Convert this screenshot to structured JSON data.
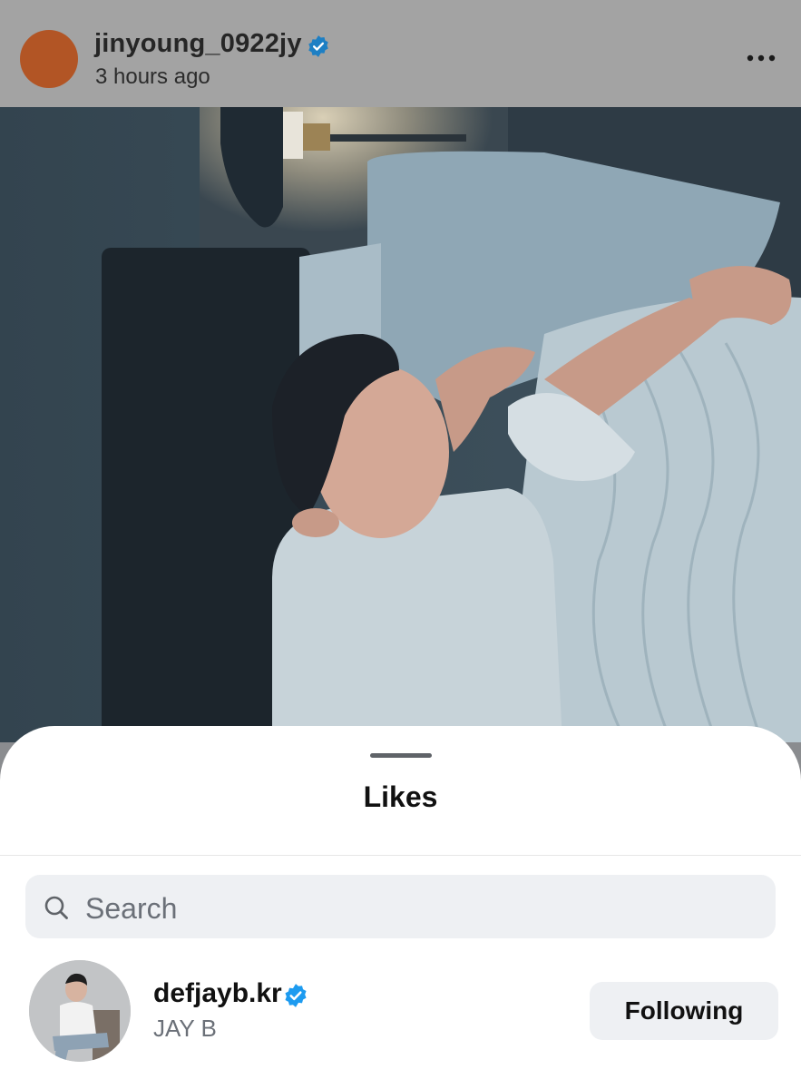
{
  "post": {
    "username": "jinyoung_0922jy",
    "time": "3 hours ago",
    "avatar_color": "#b25525"
  },
  "likes_sheet": {
    "title": "Likes",
    "search": {
      "placeholder": "Search",
      "value": ""
    },
    "users": [
      {
        "username": "defjayb.kr",
        "full_name": "JAY B",
        "verified": true,
        "button_label": "Following"
      }
    ]
  },
  "colors": {
    "verified": "#1d9bf0",
    "sheet_background": "#ffffff",
    "button_background": "#eef0f3"
  }
}
